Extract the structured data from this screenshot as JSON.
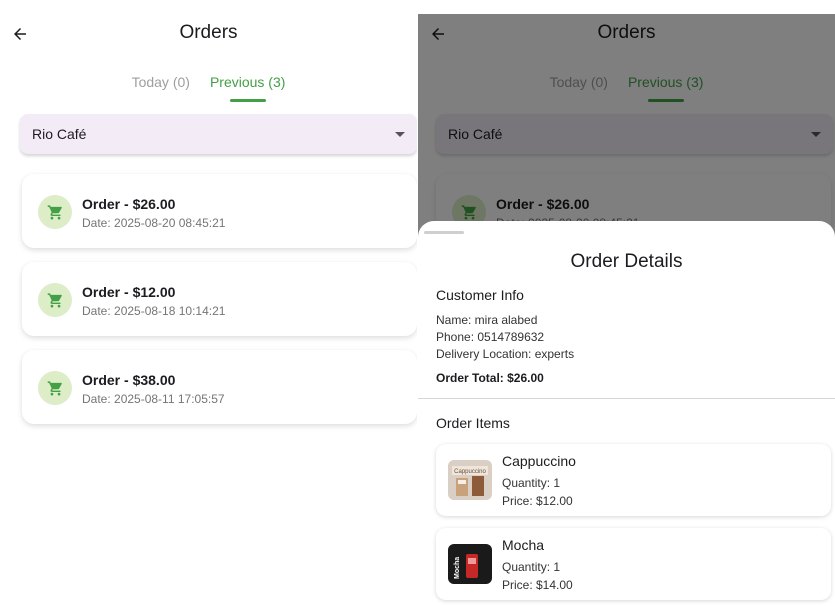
{
  "orders_screen": {
    "title": "Orders",
    "tabs": [
      {
        "label": "Today (0)",
        "active": false
      },
      {
        "label": "Previous (3)",
        "active": true
      }
    ],
    "cafe_dropdown": {
      "selected": "Rio Café"
    },
    "orders": [
      {
        "title": "Order - $26.00",
        "date": "Date: 2025-08-20 08:45:21"
      },
      {
        "title": "Order - $12.00",
        "date": "Date: 2025-08-18 10:14:21"
      },
      {
        "title": "Order - $38.00",
        "date": "Date: 2025-08-11 17:05:57"
      }
    ]
  },
  "order_details_sheet": {
    "title": "Order Details",
    "customer_info_title": "Customer Info",
    "name": "Name: mira alabed",
    "phone": "Phone: 0514789632",
    "location": "Delivery Location: experts",
    "total": "Order Total: $26.00",
    "items_title": "Order Items",
    "items": [
      {
        "name": "Cappuccino",
        "quantity": "Quantity: 1",
        "price": "Price: $12.00",
        "thumbnail_text": "Cappuccino"
      },
      {
        "name": "Mocha",
        "quantity": "Quantity: 1",
        "price": "Price: $14.00",
        "thumbnail_text": "Mocha"
      }
    ]
  },
  "colors": {
    "accent_green": "#43a047",
    "avatar_bg": "#dcedc8",
    "dropdown_bg": "#f3ecf7"
  },
  "icons": [
    "back-arrow-icon",
    "shopping-cart-icon",
    "dropdown-caret-icon"
  ]
}
